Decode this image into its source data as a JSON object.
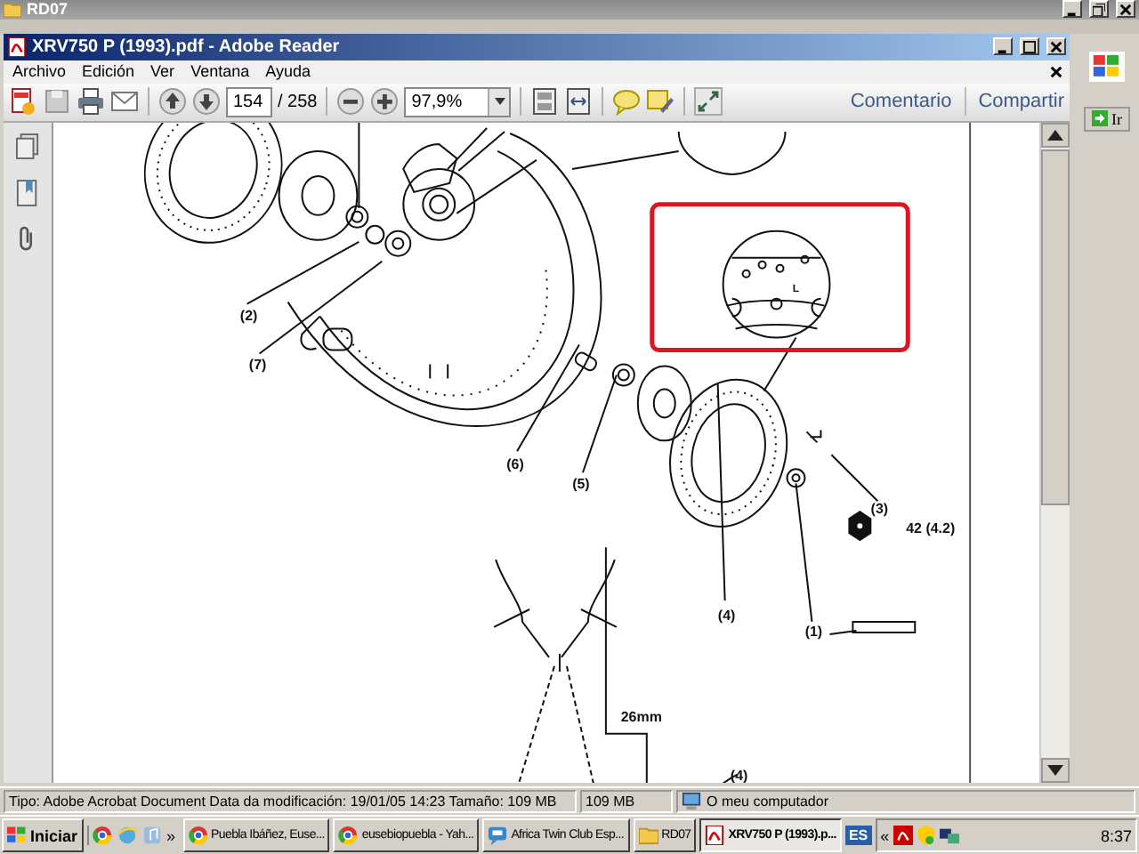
{
  "explorer_window": {
    "title": "RD07",
    "go_button": "Ir"
  },
  "reader_window": {
    "title": "XRV750 P (1993).pdf - Adobe Reader",
    "menu": [
      "Archivo",
      "Edición",
      "Ver",
      "Ventana",
      "Ayuda"
    ],
    "toolbar": {
      "page": "154",
      "page_total": "/ 258",
      "zoom": "97,9%",
      "links": [
        "Comentario",
        "Compartir"
      ]
    },
    "document": {
      "labels": [
        {
          "text": "(2)"
        },
        {
          "text": "(7)"
        },
        {
          "text": "(6)"
        },
        {
          "text": "(5)"
        },
        {
          "text": "(4)"
        },
        {
          "text": "(3)"
        },
        {
          "text": "42 (4.2)"
        },
        {
          "text": "(1)"
        },
        {
          "text": "26mm"
        },
        {
          "text": "(4)"
        },
        {
          "text": "L"
        }
      ]
    }
  },
  "status_bar": {
    "details": "Tipo: Adobe Acrobat Document Data da modificación: 19/01/05 14:23 Tamaño: 109 MB",
    "size": "109 MB",
    "location": "O meu computador"
  },
  "taskbar": {
    "start": "Iniciar",
    "overflow": "»",
    "tasks": [
      {
        "label": "Puebla Ibáñez, Euse...",
        "kind": "browser",
        "selected": false
      },
      {
        "label": "eusebiopuebla - Yah...",
        "kind": "browser",
        "selected": false
      },
      {
        "label": "Africa Twin Club Esp...",
        "kind": "chat",
        "selected": false
      },
      {
        "label": "RD07",
        "kind": "folder",
        "selected": false
      },
      {
        "label": "XRV750 P (1993).p...",
        "kind": "pdf",
        "selected": true
      }
    ],
    "language": "ES",
    "tray_overflow": "«",
    "clock": "8:37"
  }
}
